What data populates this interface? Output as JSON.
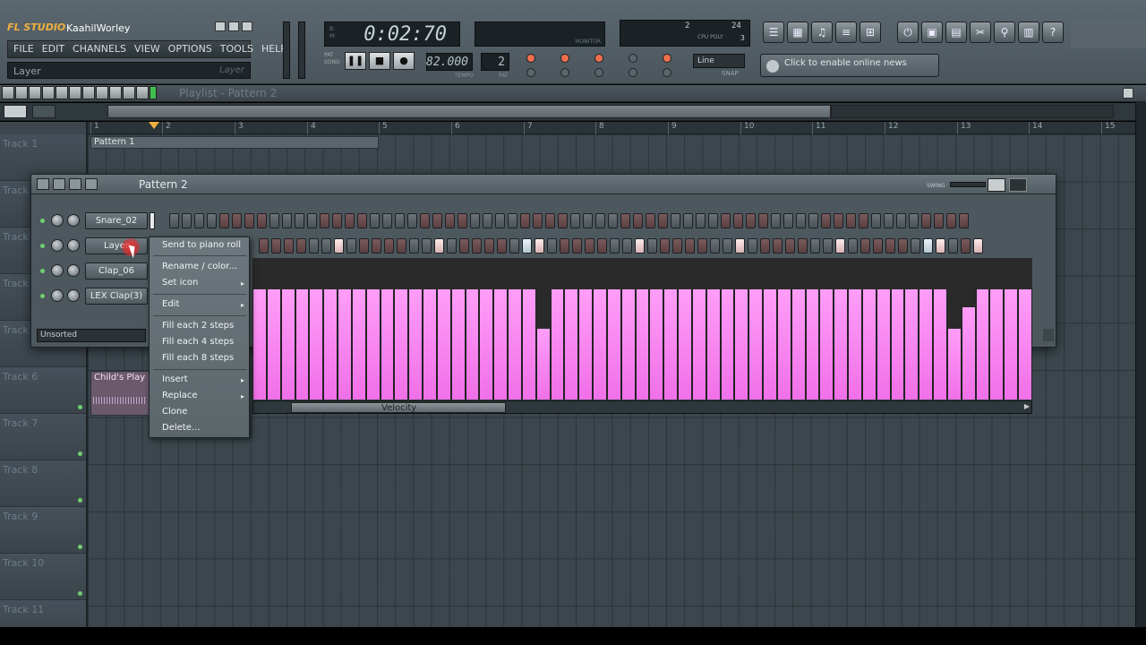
{
  "app": {
    "logo": "FL STUDIO",
    "user": "KaahilWorley"
  },
  "menu": [
    "FILE",
    "EDIT",
    "CHANNELS",
    "VIEW",
    "OPTIONS",
    "TOOLS",
    "HELP"
  ],
  "hint": {
    "text": "Layer",
    "right": "Layer"
  },
  "transport": {
    "time": "0:02:70",
    "tempo": "82.000",
    "tempo_label": "TEMPO",
    "pattern": "2",
    "pattern_label": "PAT",
    "monitor_label": "MONITOR",
    "pat_song_label": "PAT SONG"
  },
  "cpu": {
    "val1": "2",
    "val2": "24",
    "val3": "3",
    "label": "CPU POLY"
  },
  "snap": {
    "select": "Line",
    "label": "SNAP"
  },
  "news": {
    "text": "Click to enable online news"
  },
  "playlist": {
    "title": "Playlist - Pattern 2",
    "ticks": [
      "1",
      "2",
      "3",
      "4",
      "5",
      "6",
      "7",
      "8",
      "9",
      "10",
      "11",
      "12",
      "13",
      "14",
      "15"
    ],
    "tracks": [
      "Track 1",
      "Track 2",
      "Track 3",
      "Track 4",
      "Track 5",
      "Track 6",
      "Track 7",
      "Track 8",
      "Track 9",
      "Track 10",
      "Track 11"
    ],
    "clips": [
      {
        "label": "Pattern 1"
      },
      {
        "label": "Child's Play"
      }
    ]
  },
  "step_sequencer": {
    "title": "Pattern 2",
    "swing_label": "SWING",
    "filter": "Unsorted",
    "channels": [
      {
        "name": "Snare_02"
      },
      {
        "name": "Layer"
      },
      {
        "name": "Clap_06"
      },
      {
        "name": "LEX Clap(3)"
      }
    ],
    "velocity_label": "Velocity"
  },
  "context_menu": {
    "items": [
      {
        "label": "Send to piano roll",
        "submenu": false
      },
      {
        "label": "Rename / color...",
        "submenu": false
      },
      {
        "label": "Set icon",
        "submenu": true
      },
      {
        "label": "Edit",
        "submenu": true
      },
      {
        "label": "Fill each 2 steps",
        "submenu": false
      },
      {
        "label": "Fill each 4 steps",
        "submenu": false
      },
      {
        "label": "Fill each 8 steps",
        "submenu": false
      },
      {
        "label": "Insert",
        "submenu": true
      },
      {
        "label": "Replace",
        "submenu": true
      },
      {
        "label": "Clone",
        "submenu": false
      },
      {
        "label": "Delete...",
        "submenu": false
      }
    ]
  },
  "colors": {
    "velocity": "#f070e8",
    "accent": "#f0b040"
  }
}
